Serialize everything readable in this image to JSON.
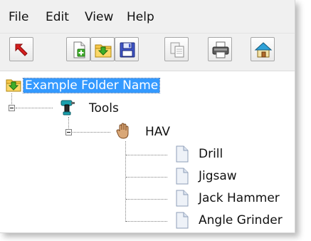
{
  "menu": {
    "file": "File",
    "edit": "Edit",
    "view": "View",
    "help": "Help"
  },
  "toolbar": {
    "buttons": [
      {
        "icon": "exit-arrow-icon"
      },
      {
        "icon": "new-file-icon"
      },
      {
        "icon": "open-folder-icon"
      },
      {
        "icon": "save-disk-icon"
      },
      {
        "icon": "copy-icon"
      },
      {
        "icon": "print-icon"
      },
      {
        "icon": "home-icon"
      }
    ]
  },
  "tree": {
    "root": {
      "label": "Example Folder Name",
      "selected": true,
      "icon": "folder-icon"
    },
    "tools": {
      "label": "Tools",
      "icon": "drill-tool-icon",
      "expanded": true
    },
    "hav": {
      "label": "HAV",
      "icon": "hand-icon",
      "expanded": true
    },
    "items": [
      {
        "label": "Drill",
        "icon": "document-icon"
      },
      {
        "label": "Jigsaw",
        "icon": "document-icon"
      },
      {
        "label": "Jack Hammer",
        "icon": "document-icon"
      },
      {
        "label": "Angle Grinder",
        "icon": "document-icon"
      }
    ]
  },
  "colors": {
    "selection": "#3399ff",
    "chrome": "#f0f0f0"
  }
}
